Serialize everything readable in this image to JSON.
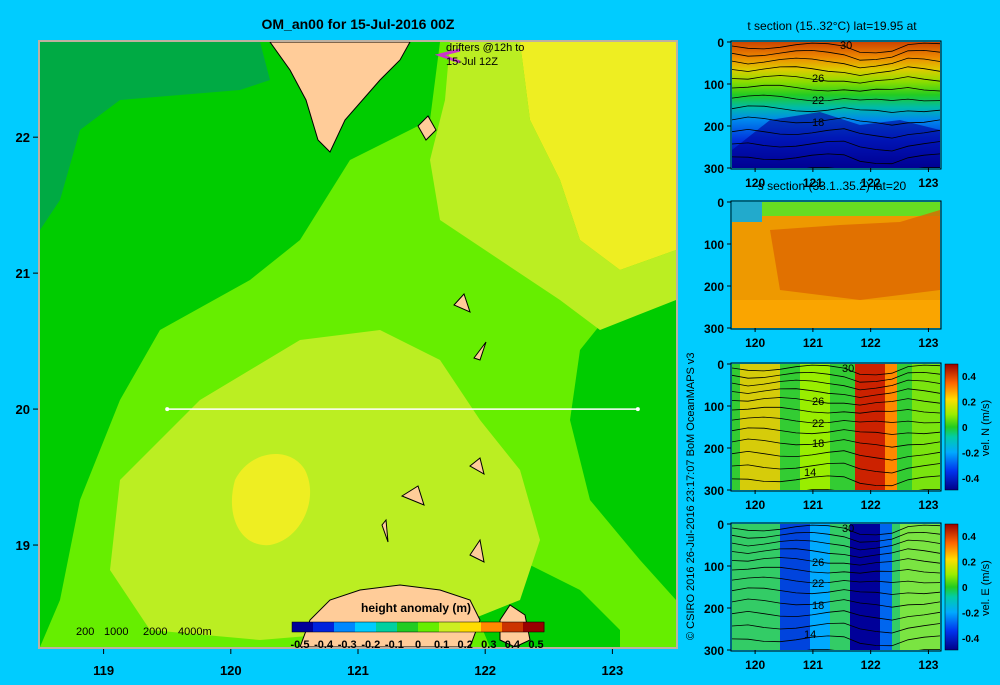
{
  "page": {
    "background": "#00ccff",
    "credit": "© CSIRO 2016   26-Jul-2016 23:17:07 BoM OceanMAPS v3"
  },
  "chart_data": [
    {
      "type": "heatmap",
      "title": "OM_an00 for 15-Jul-2016 00Z",
      "x_ticks": [
        "119",
        "120",
        "121",
        "122",
        "123"
      ],
      "y_ticks": [
        "22",
        "21",
        "20",
        "19"
      ],
      "xlim": [
        118.5,
        123.5
      ],
      "ylim": [
        18.25,
        22.7
      ],
      "section_line": {
        "lon": [
          119.5,
          123.2
        ],
        "lat": 20.0
      },
      "drifters_annotation": [
        "drifters @12h to",
        "15-Jul 12Z"
      ],
      "depth_legend": [
        "200",
        "1000",
        "2000",
        "4000m"
      ],
      "colorbar": {
        "label": "height anomaly (m)",
        "ticks": [
          "-0.5",
          "-0.4",
          "-0.3",
          "-0.2",
          "-0.1",
          "0",
          "0.1",
          "0.2",
          "0.3",
          "0.4",
          "0.5"
        ],
        "colors": [
          "#000099",
          "#0022dd",
          "#0088ff",
          "#00ccff",
          "#00d0a0",
          "#22cc22",
          "#66ee00",
          "#ccee22",
          "#ffdd00",
          "#ff8800",
          "#cc3300",
          "#990000"
        ]
      },
      "fill_colors": {
        "deep_green": "#00aa44",
        "green": "#00cc00",
        "light_green": "#66ee00",
        "yellow_green": "#bbee22",
        "yellow": "#eeee22",
        "land": "#ffcc99"
      }
    },
    {
      "type": "heatmap",
      "title": "t section (15..32°C) lat=19.95 at",
      "x_ticks": [
        "120",
        "121",
        "122",
        "123"
      ],
      "y_ticks": [
        "0",
        "100",
        "200",
        "300"
      ],
      "contour_labels": [
        "30",
        "26",
        "22",
        "18"
      ]
    },
    {
      "type": "heatmap",
      "title": "s section (33.1..35.2) lat=20",
      "x_ticks": [
        "120",
        "121",
        "122",
        "123"
      ],
      "y_ticks": [
        "0",
        "100",
        "200",
        "300"
      ]
    },
    {
      "type": "heatmap",
      "title": "",
      "x_ticks": [
        "120",
        "121",
        "122",
        "123"
      ],
      "y_ticks": [
        "0",
        "100",
        "200",
        "300"
      ],
      "contour_labels": [
        "30",
        "26",
        "22",
        "18",
        "14"
      ],
      "colorbar": {
        "label": "vel. N (m/s)",
        "ticks": [
          "0.4",
          "0.2",
          "0",
          "-0.2",
          "-0.4"
        ]
      }
    },
    {
      "type": "heatmap",
      "title": "",
      "x_ticks": [
        "120",
        "121",
        "122",
        "123"
      ],
      "y_ticks": [
        "0",
        "100",
        "200",
        "300"
      ],
      "contour_labels": [
        "30",
        "26",
        "22",
        "18",
        "14"
      ],
      "colorbar": {
        "label": "vel. E (m/s)",
        "ticks": [
          "0.4",
          "0.2",
          "0",
          "-0.2",
          "-0.4"
        ]
      }
    }
  ]
}
